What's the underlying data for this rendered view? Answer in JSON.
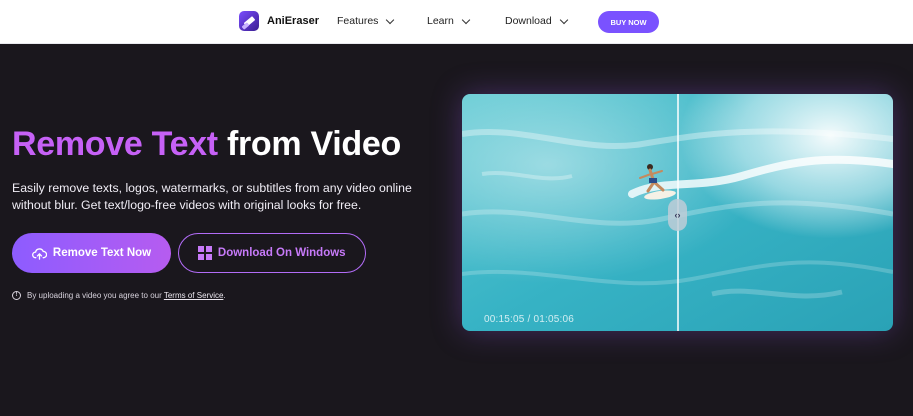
{
  "nav": {
    "brand": "AniEraser",
    "items": [
      {
        "label": "Features"
      },
      {
        "label": "Learn"
      },
      {
        "label": "Download"
      }
    ],
    "buy_label": "BUY NOW"
  },
  "hero": {
    "title_accent": "Remove Text",
    "title_rest": " from Video",
    "description": "Easily remove texts, logos, watermarks, or subtitles from any video online without blur. Get text/logo-free videos with original looks for free.",
    "primary_button": "Remove Text Now",
    "secondary_button": "Download On Windows",
    "notice_prefix": "By uploading a video you agree to our ",
    "notice_link": "Terms of Service",
    "notice_suffix": "."
  },
  "media": {
    "timecode": "00:15:05 / 01:05:06",
    "handle_glyph": "‹›"
  },
  "colors": {
    "accent": "#c661f6",
    "button_gradient_start": "#8d5cff",
    "button_gradient_end": "#b65cf0",
    "background": "#1a171d",
    "buy_button": "#7a52ff"
  }
}
